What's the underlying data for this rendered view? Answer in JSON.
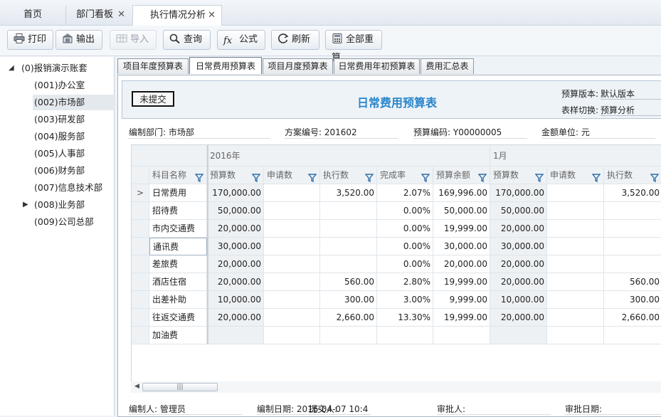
{
  "tabs": [
    {
      "label": "首页"
    },
    {
      "label": "部门看板",
      "close": "✕"
    },
    {
      "label": "执行情况分析",
      "close": "✕"
    }
  ],
  "toolbar": {
    "print": "打印",
    "export": "输出",
    "import": "导入",
    "query": "查询",
    "formula": "公式",
    "refresh": "刷新",
    "recalc": "全部重算"
  },
  "tree": {
    "root": "(0)报销演示账套",
    "items": [
      {
        "label": "(001)办公室"
      },
      {
        "label": "(002)市场部"
      },
      {
        "label": "(003)研发部"
      },
      {
        "label": "(004)服务部"
      },
      {
        "label": "(005)人事部"
      },
      {
        "label": "(006)财务部"
      },
      {
        "label": "(007)信息技术部"
      },
      {
        "label": "(008)业务部"
      },
      {
        "label": "(009)公司总部"
      }
    ],
    "selected_index": 1
  },
  "sheet_tabs": [
    "项目年度预算表",
    "日常费用预算表",
    "项目月度预算表",
    "日常费用年初预算表",
    "费用汇总表"
  ],
  "active_sheet_index": 1,
  "form": {
    "status": "未提交",
    "title": "日常费用预算表",
    "version_label": "预算版本:",
    "version_value": "默认版本",
    "style_label": "表样切换:",
    "style_value": "预算分析"
  },
  "meta": {
    "dept": "编制部门: 市场部",
    "plan": "方案编号: 201602",
    "code": "预算编码: Y00000005",
    "unit": "金额单位: 元"
  },
  "grid": {
    "group_year": "2016年",
    "group_month": "1月",
    "col_name": "科目名称",
    "year_cols": [
      "预算数",
      "申请数",
      "执行数",
      "完成率",
      "预算余额"
    ],
    "month_cols": [
      "预算数",
      "申请数",
      "执行数"
    ],
    "current_row_marker": ">",
    "rows": [
      {
        "name": "日常费用",
        "budget": "170,000.00",
        "apply": "",
        "exec": "3,520.00",
        "rate": "2.07%",
        "balance": "169,996.00",
        "m_budget": "170,000.00",
        "m_apply": "",
        "m_exec": "3,520.00"
      },
      {
        "name": "招待费",
        "budget": "50,000.00",
        "apply": "",
        "exec": "",
        "rate": "0.00%",
        "balance": "50,000.00",
        "m_budget": "50,000.00",
        "m_apply": "",
        "m_exec": ""
      },
      {
        "name": "市内交通费",
        "budget": "20,000.00",
        "apply": "",
        "exec": "",
        "rate": "0.00%",
        "balance": "19,999.00",
        "m_budget": "20,000.00",
        "m_apply": "",
        "m_exec": ""
      },
      {
        "name": "通讯费",
        "budget": "30,000.00",
        "apply": "",
        "exec": "",
        "rate": "0.00%",
        "balance": "30,000.00",
        "m_budget": "30,000.00",
        "m_apply": "",
        "m_exec": ""
      },
      {
        "name": "差旅费",
        "budget": "20,000.00",
        "apply": "",
        "exec": "",
        "rate": "0.00%",
        "balance": "20,000.00",
        "m_budget": "20,000.00",
        "m_apply": "",
        "m_exec": ""
      },
      {
        "name": "酒店住宿",
        "budget": "20,000.00",
        "apply": "",
        "exec": "560.00",
        "rate": "2.80%",
        "balance": "19,999.00",
        "m_budget": "20,000.00",
        "m_apply": "",
        "m_exec": "560.00"
      },
      {
        "name": "出差补助",
        "budget": "10,000.00",
        "apply": "",
        "exec": "300.00",
        "rate": "3.00%",
        "balance": "9,999.00",
        "m_budget": "10,000.00",
        "m_apply": "",
        "m_exec": "300.00"
      },
      {
        "name": "往返交通费",
        "budget": "20,000.00",
        "apply": "",
        "exec": "2,660.00",
        "rate": "13.30%",
        "balance": "19,999.00",
        "m_budget": "20,000.00",
        "m_apply": "",
        "m_exec": "2,660.00"
      },
      {
        "name": "加油费",
        "budget": "",
        "apply": "",
        "exec": "",
        "rate": "",
        "balance": "",
        "m_budget": "",
        "m_apply": "",
        "m_exec": ""
      }
    ],
    "scroll_grip": "|||"
  },
  "footer": {
    "maker": "编制人: 管理员",
    "date": "编制日期: 2016-04-07 10:4",
    "submit": "提交人:",
    "approver": "审批人:",
    "approve_date": "审批日期:"
  },
  "colors": {
    "accent": "#2a86cc",
    "funnel": "#2f6fa8"
  }
}
